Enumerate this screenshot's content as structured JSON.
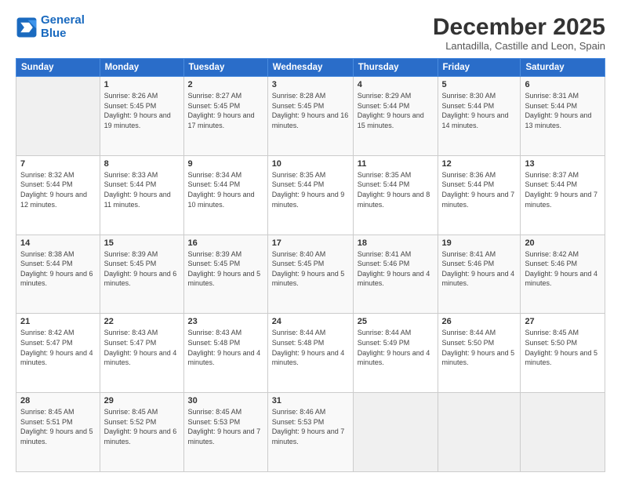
{
  "logo": {
    "line1": "General",
    "line2": "Blue"
  },
  "title": "December 2025",
  "location": "Lantadilla, Castille and Leon, Spain",
  "weekdays": [
    "Sunday",
    "Monday",
    "Tuesday",
    "Wednesday",
    "Thursday",
    "Friday",
    "Saturday"
  ],
  "weeks": [
    [
      {
        "date": "",
        "sunrise": "",
        "sunset": "",
        "daylight": ""
      },
      {
        "date": "1",
        "sunrise": "Sunrise: 8:26 AM",
        "sunset": "Sunset: 5:45 PM",
        "daylight": "Daylight: 9 hours and 19 minutes."
      },
      {
        "date": "2",
        "sunrise": "Sunrise: 8:27 AM",
        "sunset": "Sunset: 5:45 PM",
        "daylight": "Daylight: 9 hours and 17 minutes."
      },
      {
        "date": "3",
        "sunrise": "Sunrise: 8:28 AM",
        "sunset": "Sunset: 5:45 PM",
        "daylight": "Daylight: 9 hours and 16 minutes."
      },
      {
        "date": "4",
        "sunrise": "Sunrise: 8:29 AM",
        "sunset": "Sunset: 5:44 PM",
        "daylight": "Daylight: 9 hours and 15 minutes."
      },
      {
        "date": "5",
        "sunrise": "Sunrise: 8:30 AM",
        "sunset": "Sunset: 5:44 PM",
        "daylight": "Daylight: 9 hours and 14 minutes."
      },
      {
        "date": "6",
        "sunrise": "Sunrise: 8:31 AM",
        "sunset": "Sunset: 5:44 PM",
        "daylight": "Daylight: 9 hours and 13 minutes."
      }
    ],
    [
      {
        "date": "7",
        "sunrise": "Sunrise: 8:32 AM",
        "sunset": "Sunset: 5:44 PM",
        "daylight": "Daylight: 9 hours and 12 minutes."
      },
      {
        "date": "8",
        "sunrise": "Sunrise: 8:33 AM",
        "sunset": "Sunset: 5:44 PM",
        "daylight": "Daylight: 9 hours and 11 minutes."
      },
      {
        "date": "9",
        "sunrise": "Sunrise: 8:34 AM",
        "sunset": "Sunset: 5:44 PM",
        "daylight": "Daylight: 9 hours and 10 minutes."
      },
      {
        "date": "10",
        "sunrise": "Sunrise: 8:35 AM",
        "sunset": "Sunset: 5:44 PM",
        "daylight": "Daylight: 9 hours and 9 minutes."
      },
      {
        "date": "11",
        "sunrise": "Sunrise: 8:35 AM",
        "sunset": "Sunset: 5:44 PM",
        "daylight": "Daylight: 9 hours and 8 minutes."
      },
      {
        "date": "12",
        "sunrise": "Sunrise: 8:36 AM",
        "sunset": "Sunset: 5:44 PM",
        "daylight": "Daylight: 9 hours and 7 minutes."
      },
      {
        "date": "13",
        "sunrise": "Sunrise: 8:37 AM",
        "sunset": "Sunset: 5:44 PM",
        "daylight": "Daylight: 9 hours and 7 minutes."
      }
    ],
    [
      {
        "date": "14",
        "sunrise": "Sunrise: 8:38 AM",
        "sunset": "Sunset: 5:44 PM",
        "daylight": "Daylight: 9 hours and 6 minutes."
      },
      {
        "date": "15",
        "sunrise": "Sunrise: 8:39 AM",
        "sunset": "Sunset: 5:45 PM",
        "daylight": "Daylight: 9 hours and 6 minutes."
      },
      {
        "date": "16",
        "sunrise": "Sunrise: 8:39 AM",
        "sunset": "Sunset: 5:45 PM",
        "daylight": "Daylight: 9 hours and 5 minutes."
      },
      {
        "date": "17",
        "sunrise": "Sunrise: 8:40 AM",
        "sunset": "Sunset: 5:45 PM",
        "daylight": "Daylight: 9 hours and 5 minutes."
      },
      {
        "date": "18",
        "sunrise": "Sunrise: 8:41 AM",
        "sunset": "Sunset: 5:46 PM",
        "daylight": "Daylight: 9 hours and 4 minutes."
      },
      {
        "date": "19",
        "sunrise": "Sunrise: 8:41 AM",
        "sunset": "Sunset: 5:46 PM",
        "daylight": "Daylight: 9 hours and 4 minutes."
      },
      {
        "date": "20",
        "sunrise": "Sunrise: 8:42 AM",
        "sunset": "Sunset: 5:46 PM",
        "daylight": "Daylight: 9 hours and 4 minutes."
      }
    ],
    [
      {
        "date": "21",
        "sunrise": "Sunrise: 8:42 AM",
        "sunset": "Sunset: 5:47 PM",
        "daylight": "Daylight: 9 hours and 4 minutes."
      },
      {
        "date": "22",
        "sunrise": "Sunrise: 8:43 AM",
        "sunset": "Sunset: 5:47 PM",
        "daylight": "Daylight: 9 hours and 4 minutes."
      },
      {
        "date": "23",
        "sunrise": "Sunrise: 8:43 AM",
        "sunset": "Sunset: 5:48 PM",
        "daylight": "Daylight: 9 hours and 4 minutes."
      },
      {
        "date": "24",
        "sunrise": "Sunrise: 8:44 AM",
        "sunset": "Sunset: 5:48 PM",
        "daylight": "Daylight: 9 hours and 4 minutes."
      },
      {
        "date": "25",
        "sunrise": "Sunrise: 8:44 AM",
        "sunset": "Sunset: 5:49 PM",
        "daylight": "Daylight: 9 hours and 4 minutes."
      },
      {
        "date": "26",
        "sunrise": "Sunrise: 8:44 AM",
        "sunset": "Sunset: 5:50 PM",
        "daylight": "Daylight: 9 hours and 5 minutes."
      },
      {
        "date": "27",
        "sunrise": "Sunrise: 8:45 AM",
        "sunset": "Sunset: 5:50 PM",
        "daylight": "Daylight: 9 hours and 5 minutes."
      }
    ],
    [
      {
        "date": "28",
        "sunrise": "Sunrise: 8:45 AM",
        "sunset": "Sunset: 5:51 PM",
        "daylight": "Daylight: 9 hours and 5 minutes."
      },
      {
        "date": "29",
        "sunrise": "Sunrise: 8:45 AM",
        "sunset": "Sunset: 5:52 PM",
        "daylight": "Daylight: 9 hours and 6 minutes."
      },
      {
        "date": "30",
        "sunrise": "Sunrise: 8:45 AM",
        "sunset": "Sunset: 5:53 PM",
        "daylight": "Daylight: 9 hours and 7 minutes."
      },
      {
        "date": "31",
        "sunrise": "Sunrise: 8:46 AM",
        "sunset": "Sunset: 5:53 PM",
        "daylight": "Daylight: 9 hours and 7 minutes."
      },
      {
        "date": "",
        "sunrise": "",
        "sunset": "",
        "daylight": ""
      },
      {
        "date": "",
        "sunrise": "",
        "sunset": "",
        "daylight": ""
      },
      {
        "date": "",
        "sunrise": "",
        "sunset": "",
        "daylight": ""
      }
    ]
  ]
}
